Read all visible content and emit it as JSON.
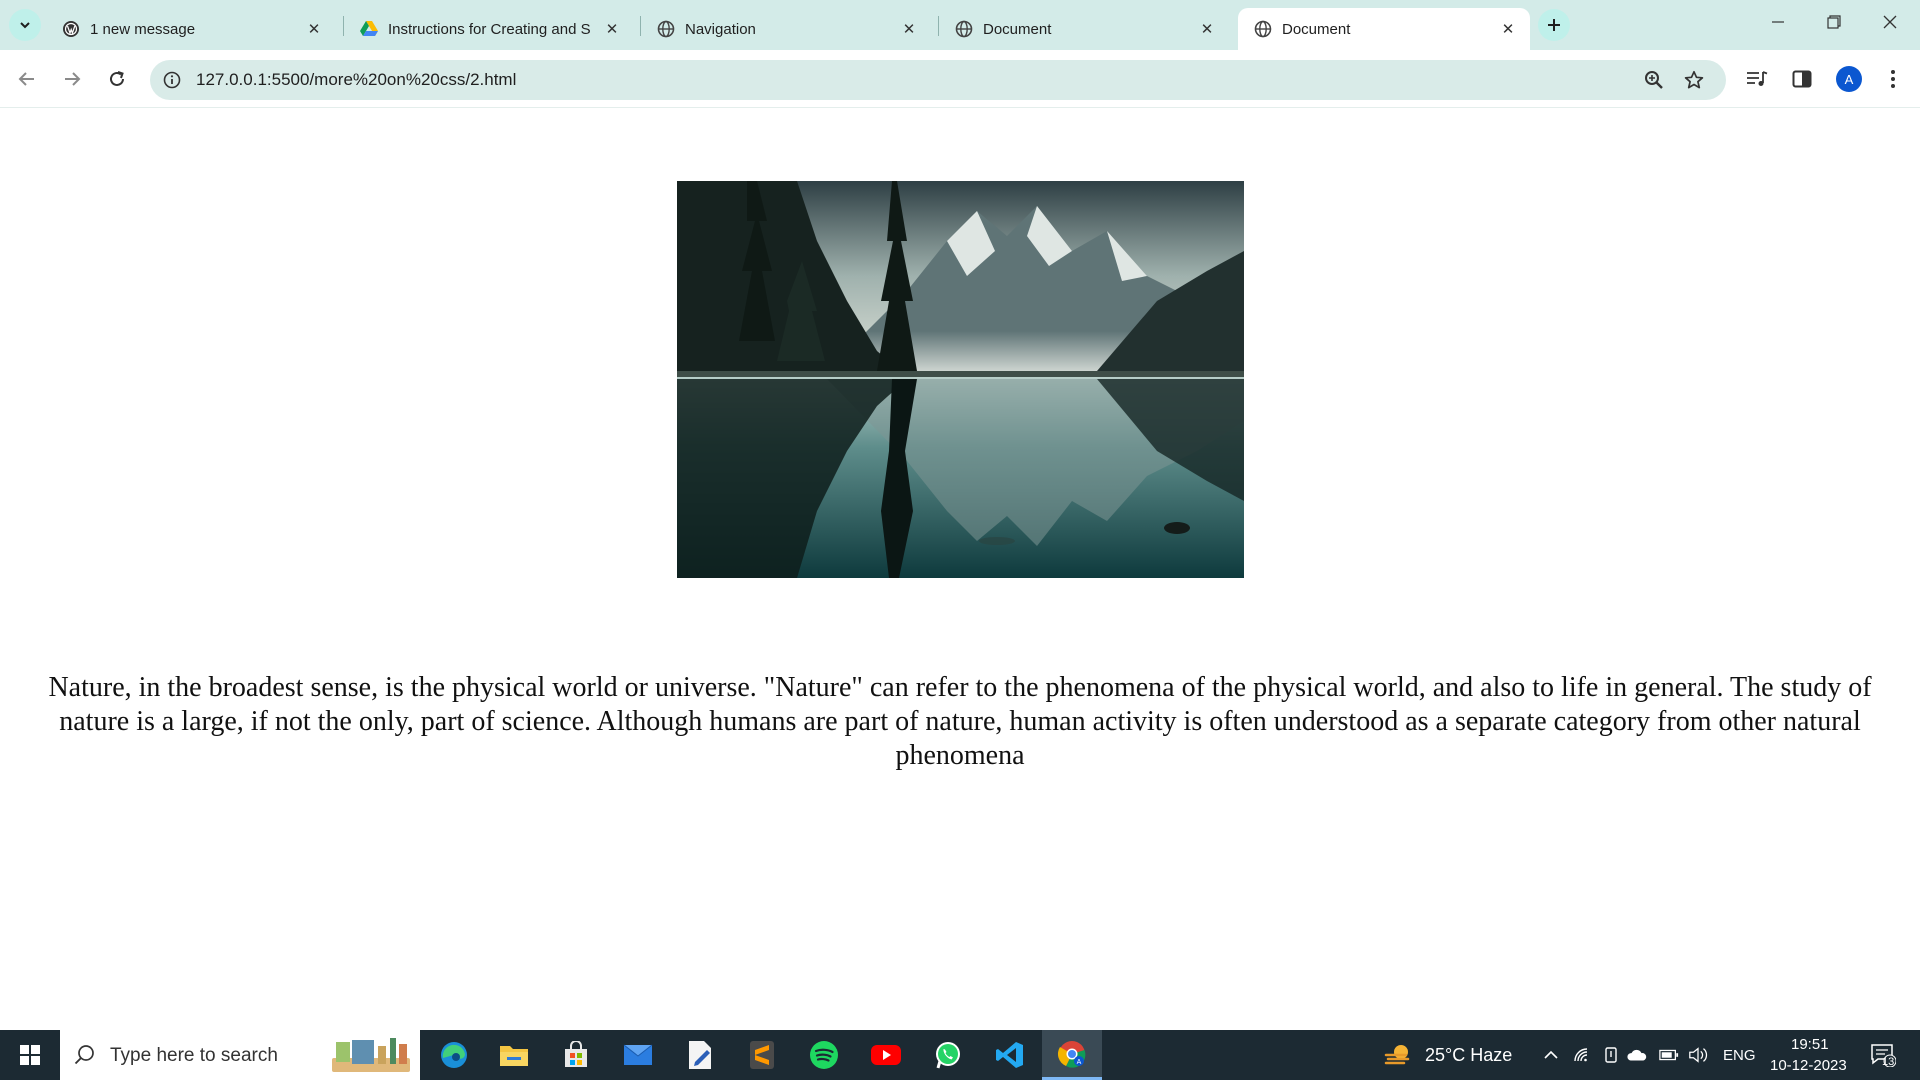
{
  "tabs": [
    {
      "title": "1 new message",
      "icon": "wordpress-icon"
    },
    {
      "title": "Instructions for Creating and S",
      "icon": "google-drive-icon"
    },
    {
      "title": "Navigation",
      "icon": "globe-icon"
    },
    {
      "title": "Document",
      "icon": "globe-icon"
    },
    {
      "title": "Document",
      "icon": "globe-icon",
      "active": true
    }
  ],
  "toolbar": {
    "url": "127.0.0.1:5500/more%20on%20css/2.html",
    "profile_initial": "A"
  },
  "page": {
    "image_description_icon": "mountain-lake-image",
    "paragraph": "Nature, in the broadest sense, is the physical world or universe. \"Nature\" can refer to the phenomena of the physical world, and also to life in general. The study of nature is a large, if not the only, part of science. Although humans are part of nature, human activity is often understood as a separate category from other natural phenomena"
  },
  "taskbar": {
    "search_placeholder": "Type here to search",
    "weather": "25°C  Haze",
    "language": "ENG",
    "time": "19:51",
    "date": "10-12-2023",
    "notification_count": "13"
  },
  "colors": {
    "tab_strip": "#d3ebe8",
    "omnibox": "#d9ebe8",
    "taskbar": "#1c2a33",
    "accent": "#0b57d0"
  }
}
